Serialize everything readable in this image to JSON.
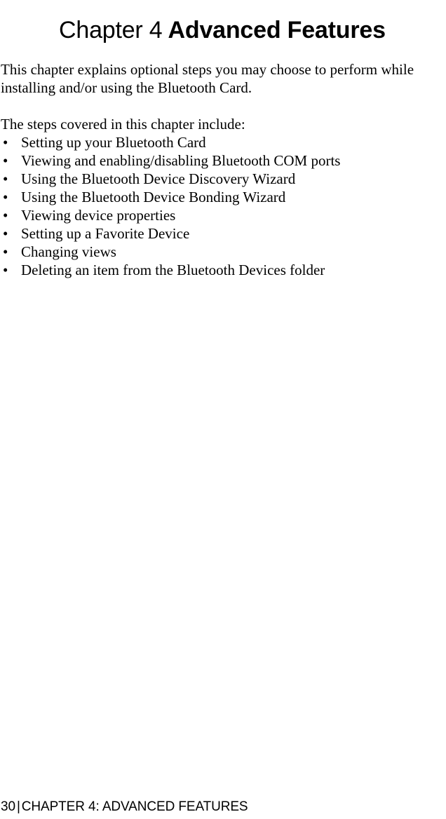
{
  "document": {
    "kind": "manual-page",
    "background_color": "#ffffff",
    "text_color": "#000000"
  },
  "heading": {
    "chapter_label": "Chapter 4",
    "chapter_name": "Advanced Features",
    "separator_space": " "
  },
  "intro": {
    "line1": "This chapter explains optional steps you may choose to perform while",
    "line2": "installing and/or using the Bluetooth Card."
  },
  "lead_in": "The steps covered in this chapter include:",
  "bullets": {
    "marker": "•",
    "items": [
      {
        "label": "Setting up your Bluetooth Card"
      },
      {
        "label": "Viewing and enabling/disabling Bluetooth COM ports"
      },
      {
        "label": "Using the Bluetooth Device Discovery Wizard"
      },
      {
        "label": "Using the Bluetooth Device Bonding Wizard"
      },
      {
        "label": "Viewing device properties"
      },
      {
        "label": "Setting up a Favorite Device"
      },
      {
        "label": "Changing views"
      },
      {
        "label": "Deleting an item from the Bluetooth Devices folder"
      }
    ]
  },
  "footer": {
    "page_number": "30",
    "separator": "|",
    "running_head": "CHAPTER 4: ADVANCED FEATURES"
  }
}
